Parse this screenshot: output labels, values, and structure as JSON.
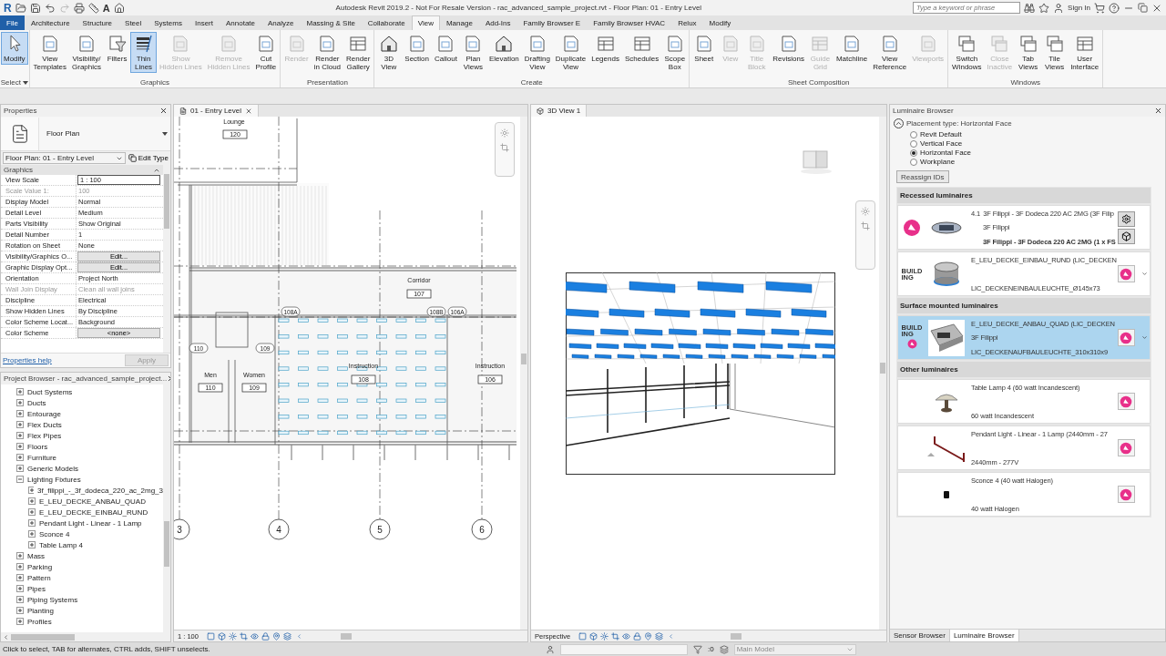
{
  "title_bar": {
    "app_logo": "R",
    "text_tool": "A",
    "title": "Autodesk Revit 2019.2 - Not For Resale Version - rac_advanced_sample_project.rvt - Floor Plan: 01 - Entry Level",
    "search": {
      "placeholder": "Type a keyword or phrase"
    },
    "sign_in": "Sign In"
  },
  "ribbon_tabs": [
    {
      "label": "File",
      "kind": "file",
      "selected": false
    },
    {
      "label": "Architecture",
      "kind": "tab",
      "selected": false
    },
    {
      "label": "Structure",
      "kind": "tab",
      "selected": false
    },
    {
      "label": "Steel",
      "kind": "tab",
      "selected": false
    },
    {
      "label": "Systems",
      "kind": "tab",
      "selected": false
    },
    {
      "label": "Insert",
      "kind": "tab",
      "selected": false
    },
    {
      "label": "Annotate",
      "kind": "tab",
      "selected": false
    },
    {
      "label": "Analyze",
      "kind": "tab",
      "selected": false
    },
    {
      "label": "Massing & Site",
      "kind": "tab",
      "selected": false
    },
    {
      "label": "Collaborate",
      "kind": "tab",
      "selected": false
    },
    {
      "label": "View",
      "kind": "tab",
      "selected": true
    },
    {
      "label": "Manage",
      "kind": "tab",
      "selected": false
    },
    {
      "label": "Add-Ins",
      "kind": "tab",
      "selected": false
    },
    {
      "label": "Family Browser E",
      "kind": "tab",
      "selected": false
    },
    {
      "label": "Family Browser HVAC",
      "kind": "tab",
      "selected": false
    },
    {
      "label": "Relux",
      "kind": "tab",
      "selected": false
    },
    {
      "label": "Modify",
      "kind": "tab",
      "selected": false
    }
  ],
  "ribbon_groups": [
    {
      "label": "Select",
      "buttons": [
        {
          "label": "Modify",
          "selected": true,
          "disabled": false
        }
      ]
    },
    {
      "label": "Graphics",
      "buttons": [
        {
          "label": "View\nTemplates",
          "selected": false,
          "disabled": false
        },
        {
          "label": "Visibility/\nGraphics",
          "selected": false,
          "disabled": false
        },
        {
          "label": "Filters",
          "selected": false,
          "disabled": false
        },
        {
          "label": "Thin\nLines",
          "selected": true,
          "disabled": false
        },
        {
          "label": "Show\nHidden Lines",
          "selected": false,
          "disabled": true
        },
        {
          "label": "Remove\nHidden Lines",
          "selected": false,
          "disabled": true
        },
        {
          "label": "Cut\nProfile",
          "selected": false,
          "disabled": false
        }
      ]
    },
    {
      "label": "Presentation",
      "buttons": [
        {
          "label": "Render",
          "selected": false,
          "disabled": true
        },
        {
          "label": "Render\nin Cloud",
          "selected": false,
          "disabled": false
        },
        {
          "label": "Render\nGallery",
          "selected": false,
          "disabled": false
        }
      ]
    },
    {
      "label": "Create",
      "buttons": [
        {
          "label": "3D\nView",
          "selected": false,
          "disabled": false
        },
        {
          "label": "Section",
          "selected": false,
          "disabled": false
        },
        {
          "label": "Callout",
          "selected": false,
          "disabled": false
        },
        {
          "label": "Plan\nViews",
          "selected": false,
          "disabled": false
        },
        {
          "label": "Elevation",
          "selected": false,
          "disabled": false
        },
        {
          "label": "Drafting\nView",
          "selected": false,
          "disabled": false
        },
        {
          "label": "Duplicate\nView",
          "selected": false,
          "disabled": false
        },
        {
          "label": "Legends",
          "selected": false,
          "disabled": false
        },
        {
          "label": "Schedules",
          "selected": false,
          "disabled": false
        },
        {
          "label": "Scope\nBox",
          "selected": false,
          "disabled": false
        }
      ]
    },
    {
      "label": "Sheet Composition",
      "buttons": [
        {
          "label": "Sheet",
          "selected": false,
          "disabled": false
        },
        {
          "label": "View",
          "selected": false,
          "disabled": true
        },
        {
          "label": "Title\nBlock",
          "selected": false,
          "disabled": true
        },
        {
          "label": "Revisions",
          "selected": false,
          "disabled": false
        },
        {
          "label": "Guide\nGrid",
          "selected": false,
          "disabled": true
        },
        {
          "label": "Matchline",
          "selected": false,
          "disabled": false
        },
        {
          "label": "View\nReference",
          "selected": false,
          "disabled": false
        },
        {
          "label": "Viewports",
          "selected": false,
          "disabled": true
        }
      ]
    },
    {
      "label": "Windows",
      "buttons": [
        {
          "label": "Switch\nWindows",
          "selected": false,
          "disabled": false
        },
        {
          "label": "Close\nInactive",
          "selected": false,
          "disabled": true
        },
        {
          "label": "Tab\nViews",
          "selected": false,
          "disabled": false
        },
        {
          "label": "Tile\nViews",
          "selected": false,
          "disabled": false
        },
        {
          "label": "User\nInterface",
          "selected": false,
          "disabled": false
        }
      ]
    }
  ],
  "properties": {
    "title": "Properties",
    "type": "Floor Plan",
    "instance": "Floor Plan: 01 - Entry Level",
    "edit_type": "Edit Type",
    "section": "Graphics",
    "rows": [
      {
        "name": "View Scale",
        "value": "1 : 100",
        "kind": "input",
        "disabled": false
      },
      {
        "name": "Scale Value    1:",
        "value": "100",
        "kind": "text",
        "disabled": true
      },
      {
        "name": "Display Model",
        "value": "Normal",
        "kind": "text",
        "disabled": false
      },
      {
        "name": "Detail Level",
        "value": "Medium",
        "kind": "text",
        "disabled": false
      },
      {
        "name": "Parts Visibility",
        "value": "Show Original",
        "kind": "text",
        "disabled": false
      },
      {
        "name": "Detail Number",
        "value": "1",
        "kind": "text",
        "disabled": false
      },
      {
        "name": "Rotation on Sheet",
        "value": "None",
        "kind": "text",
        "disabled": false
      },
      {
        "name": "Visibility/Graphics O...",
        "value": "Edit...",
        "kind": "button",
        "disabled": false
      },
      {
        "name": "Graphic Display Opt...",
        "value": "Edit...",
        "kind": "button",
        "disabled": false
      },
      {
        "name": "Orientation",
        "value": "Project North",
        "kind": "text",
        "disabled": false
      },
      {
        "name": "Wall Join Display",
        "value": "Clean all wall joins",
        "kind": "text",
        "disabled": true
      },
      {
        "name": "Discipline",
        "value": "Electrical",
        "kind": "text",
        "disabled": false
      },
      {
        "name": "Show Hidden Lines",
        "value": "By Discipline",
        "kind": "text",
        "disabled": false
      },
      {
        "name": "Color Scheme Locat...",
        "value": "Background",
        "kind": "text",
        "disabled": false
      },
      {
        "name": "Color Scheme",
        "value": "<none>",
        "kind": "button",
        "disabled": false
      }
    ],
    "help": "Properties help",
    "apply": "Apply"
  },
  "project_browser": {
    "title": "Project Browser - rac_advanced_sample_project...",
    "items": [
      {
        "label": "Duct Systems",
        "expanded": false
      },
      {
        "label": "Ducts",
        "expanded": false
      },
      {
        "label": "Entourage",
        "expanded": false
      },
      {
        "label": "Flex Ducts",
        "expanded": false
      },
      {
        "label": "Flex Pipes",
        "expanded": false
      },
      {
        "label": "Floors",
        "expanded": false
      },
      {
        "label": "Furniture",
        "expanded": false
      },
      {
        "label": "Generic Models",
        "expanded": false
      },
      {
        "label": "Lighting Fixtures",
        "expanded": true,
        "children": [
          {
            "label": "3f_filippi_-_3f_dodeca_220_ac_2mg_3",
            "expanded": false
          },
          {
            "label": "E_LEU_DECKE_ANBAU_QUAD",
            "expanded": false
          },
          {
            "label": "E_LEU_DECKE_EINBAU_RUND",
            "expanded": false
          },
          {
            "label": "Pendant Light - Linear - 1 Lamp",
            "expanded": false
          },
          {
            "label": "Sconce 4",
            "expanded": false
          },
          {
            "label": "Table Lamp 4",
            "expanded": false
          }
        ]
      },
      {
        "label": "Mass",
        "expanded": false
      },
      {
        "label": "Parking",
        "expanded": false
      },
      {
        "label": "Pattern",
        "expanded": false
      },
      {
        "label": "Pipes",
        "expanded": false
      },
      {
        "label": "Piping Systems",
        "expanded": false
      },
      {
        "label": "Planting",
        "expanded": false
      },
      {
        "label": "Profiles",
        "expanded": false
      }
    ]
  },
  "plan_view": {
    "tab": "01 - Entry Level",
    "rooms": [
      {
        "name": "Lounge",
        "number": "120"
      },
      {
        "name": "Corridor",
        "number": "107"
      },
      {
        "name": "Men",
        "number": "110"
      },
      {
        "name": "Women",
        "number": "109"
      },
      {
        "name": "Instruction",
        "number": "108"
      },
      {
        "name": "Instruction",
        "number": "106"
      }
    ],
    "door_tags": [
      "108A",
      "108B",
      "106A",
      "110",
      "109"
    ],
    "grids": [
      "3",
      "4",
      "5",
      "6"
    ],
    "scale": "1 : 100"
  },
  "model_view": {
    "tab": "3D View 1",
    "mode": "Perspective"
  },
  "luminaire_browser": {
    "title": "Luminaire Browser",
    "placement": "Placement type: Horizontal Face",
    "options": [
      {
        "label": "Revit Default",
        "selected": false
      },
      {
        "label": "Vertical Face",
        "selected": false
      },
      {
        "label": "Horizontal Face",
        "selected": true
      },
      {
        "label": "Workplane",
        "selected": false
      }
    ],
    "reassign": "Reassign IDs",
    "sections": [
      {
        "title": "Recessed luminaires",
        "items": [
          {
            "kind": "relux",
            "code": "4.1",
            "name": "3F Filippi - 3F Dodeca 220 AC 2MG (3F Filip",
            "maker": "3F Filippi",
            "description": "3F Filippi - 3F Dodeca 220 AC 2MG (1 x FS",
            "selected": false
          },
          {
            "kind": "building360",
            "brand": "BUILD\nING",
            "name": "E_LEU_DECKE_EINBAU_RUND (LIC_DECKEN",
            "description": "LIC_DECKENEINBAULEUCHTE_Ø145x73",
            "placed": false,
            "selected": false
          }
        ]
      },
      {
        "title": "Surface mounted luminaires",
        "items": [
          {
            "kind": "building360",
            "brand": "BUILD\nING",
            "name": "E_LEU_DECKE_ANBAU_QUAD (LIC_DECKEN",
            "maker": "3F Filippi",
            "description": "LIC_DECKENAUFBAULEUCHTE_310x310x9",
            "placed": true,
            "selected": true
          }
        ]
      },
      {
        "title": "Other luminaires",
        "items": [
          {
            "kind": "revit",
            "name": "Table Lamp 4 (60 watt Incandescent)",
            "description": "60 watt Incandescent",
            "selected": false
          },
          {
            "kind": "revit",
            "name": "Pendant Light - Linear - 1 Lamp (2440mm - 27",
            "description": "2440mm - 277V",
            "selected": false
          },
          {
            "kind": "revit",
            "name": "Sconce 4 (40 watt Halogen)",
            "description": "40 watt Halogen",
            "selected": false
          }
        ]
      }
    ]
  },
  "bottom_tabs": [
    {
      "label": "Sensor Browser",
      "selected": false
    },
    {
      "label": "Luminaire Browser",
      "selected": true
    }
  ],
  "status_bar": {
    "hint": "Click to select, TAB for alternates, CTRL adds, SHIFT unselects.",
    "count": ":0",
    "model": "Main Model"
  }
}
